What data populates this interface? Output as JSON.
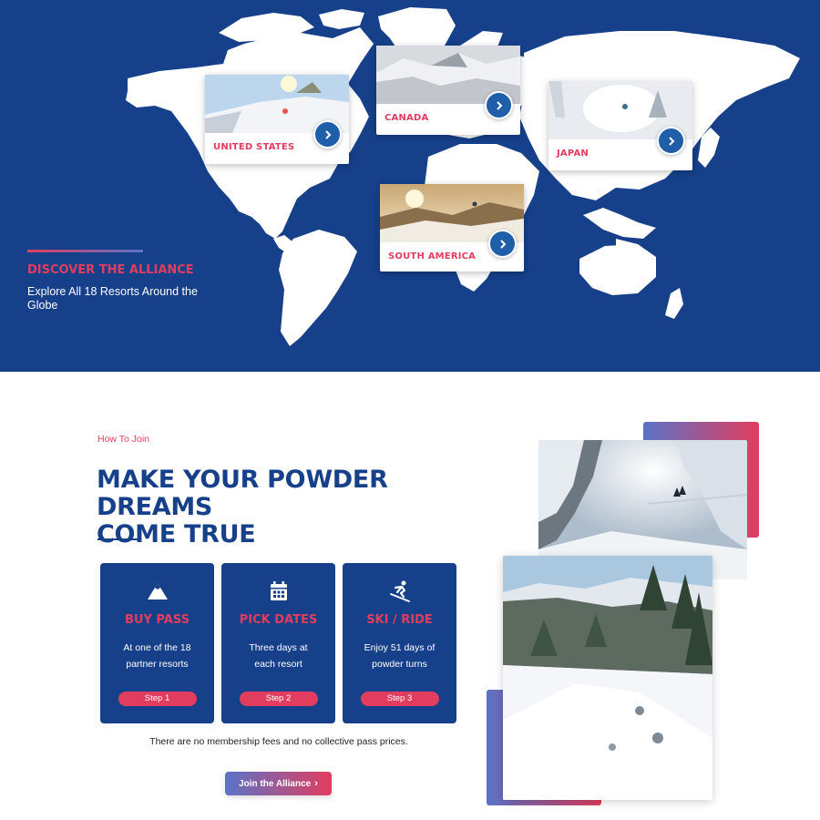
{
  "map": {
    "regions": [
      {
        "name": "UNITED STATES",
        "icon": "chevron-right-icon"
      },
      {
        "name": "CANADA",
        "icon": "chevron-right-icon"
      },
      {
        "name": "JAPAN",
        "icon": "chevron-right-icon"
      },
      {
        "name": "SOUTH AMERICA",
        "icon": "chevron-right-icon"
      }
    ],
    "discover_title": "DISCOVER THE ALLIANCE",
    "discover_subtitle": "Explore All 18 Resorts Around the Globe"
  },
  "join": {
    "eyebrow": "How To Join",
    "headline_line1": "MAKE YOUR POWDER DREAMS",
    "headline_line2": "COME TRUE",
    "steps": [
      {
        "icon": "mountain-icon",
        "title": "BUY PASS",
        "line1": "At one of the 18",
        "line2": "partner resorts",
        "pill": "Step 1"
      },
      {
        "icon": "calendar-icon",
        "title": "PICK DATES",
        "line1": "Three days at",
        "line2": "each resort",
        "pill": "Step 2"
      },
      {
        "icon": "skier-icon",
        "title": "SKI / RIDE",
        "line1": "Enjoy 51 days of",
        "line2": "powder turns",
        "pill": "Step 3"
      }
    ],
    "note": "There are no membership fees and no collective pass prices.",
    "cta_label": "Join the Alliance",
    "cta_icon": "chevron-right-icon"
  },
  "colors": {
    "navy": "#16408a",
    "accent_pink": "#e23d5e",
    "gradient_blue": "#5a73c8",
    "button_blue": "#1f5ea8"
  }
}
